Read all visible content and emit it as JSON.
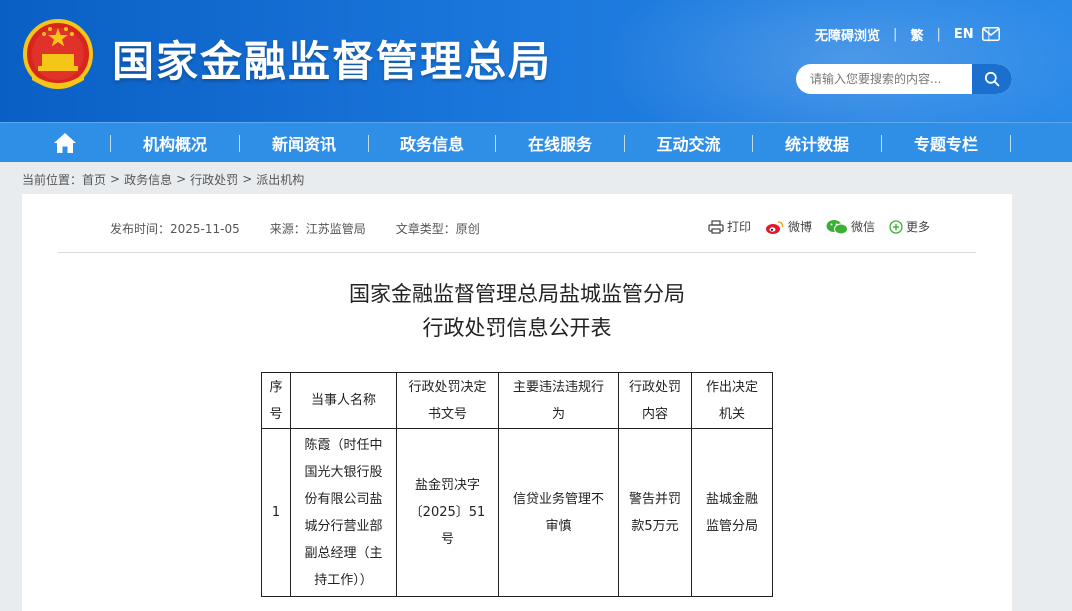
{
  "header": {
    "site_title": "国家金融监督管理总局",
    "toplinks": [
      "无障碍浏览",
      "繁",
      "EN"
    ],
    "mail_icon": "mail-icon",
    "emblem_icon": "national-emblem-icon",
    "search_placeholder": "请输入您要搜索的内容...",
    "search_icon": "search-icon"
  },
  "nav": {
    "home_icon": "home-icon",
    "items": [
      "机构概况",
      "新闻资讯",
      "政务信息",
      "在线服务",
      "互动交流",
      "统计数据",
      "专题专栏"
    ]
  },
  "breadcrumb": {
    "label": "当前位置：",
    "items": [
      "首页",
      "政务信息",
      "行政处罚",
      "派出机构"
    ]
  },
  "article": {
    "publish_time": "发布时间：2025-11-05",
    "source": "来源：江苏监管局",
    "type": "文章类型：原创",
    "share": {
      "print": "打印",
      "weibo": "微博",
      "wechat": "微信",
      "more": "更多"
    },
    "title_line1": "国家金融监督管理总局盐城监管分局",
    "title_line2": "行政处罚信息公开表"
  },
  "table": {
    "headers": {
      "no": [
        "序",
        "号"
      ],
      "party": [
        "当事人名称"
      ],
      "doc_no": [
        "行政处罚决定",
        "书文号"
      ],
      "violation": [
        "主要违法违规行",
        "为"
      ],
      "penalty": [
        "行政处罚",
        "内容"
      ],
      "authority": [
        "作出决定",
        "机关"
      ]
    },
    "rows": [
      {
        "no": "1",
        "party": [
          "陈霞（时任中",
          "国光大银行股",
          "份有限公司盐",
          "城分行营业部",
          "副总经理（主",
          "持工作））"
        ],
        "doc_no": [
          "盐金罚决字",
          "〔2025〕51",
          "号"
        ],
        "violation": [
          "信贷业务管理不",
          "审慎"
        ],
        "penalty": [
          "警告并罚",
          "款5万元"
        ],
        "authority": [
          "盐城金融",
          "监管分局"
        ]
      }
    ]
  },
  "colors": {
    "header_blue": "#1a76db",
    "nav_blue": "#2f8fe6",
    "page_bg": "#e9ecef"
  }
}
